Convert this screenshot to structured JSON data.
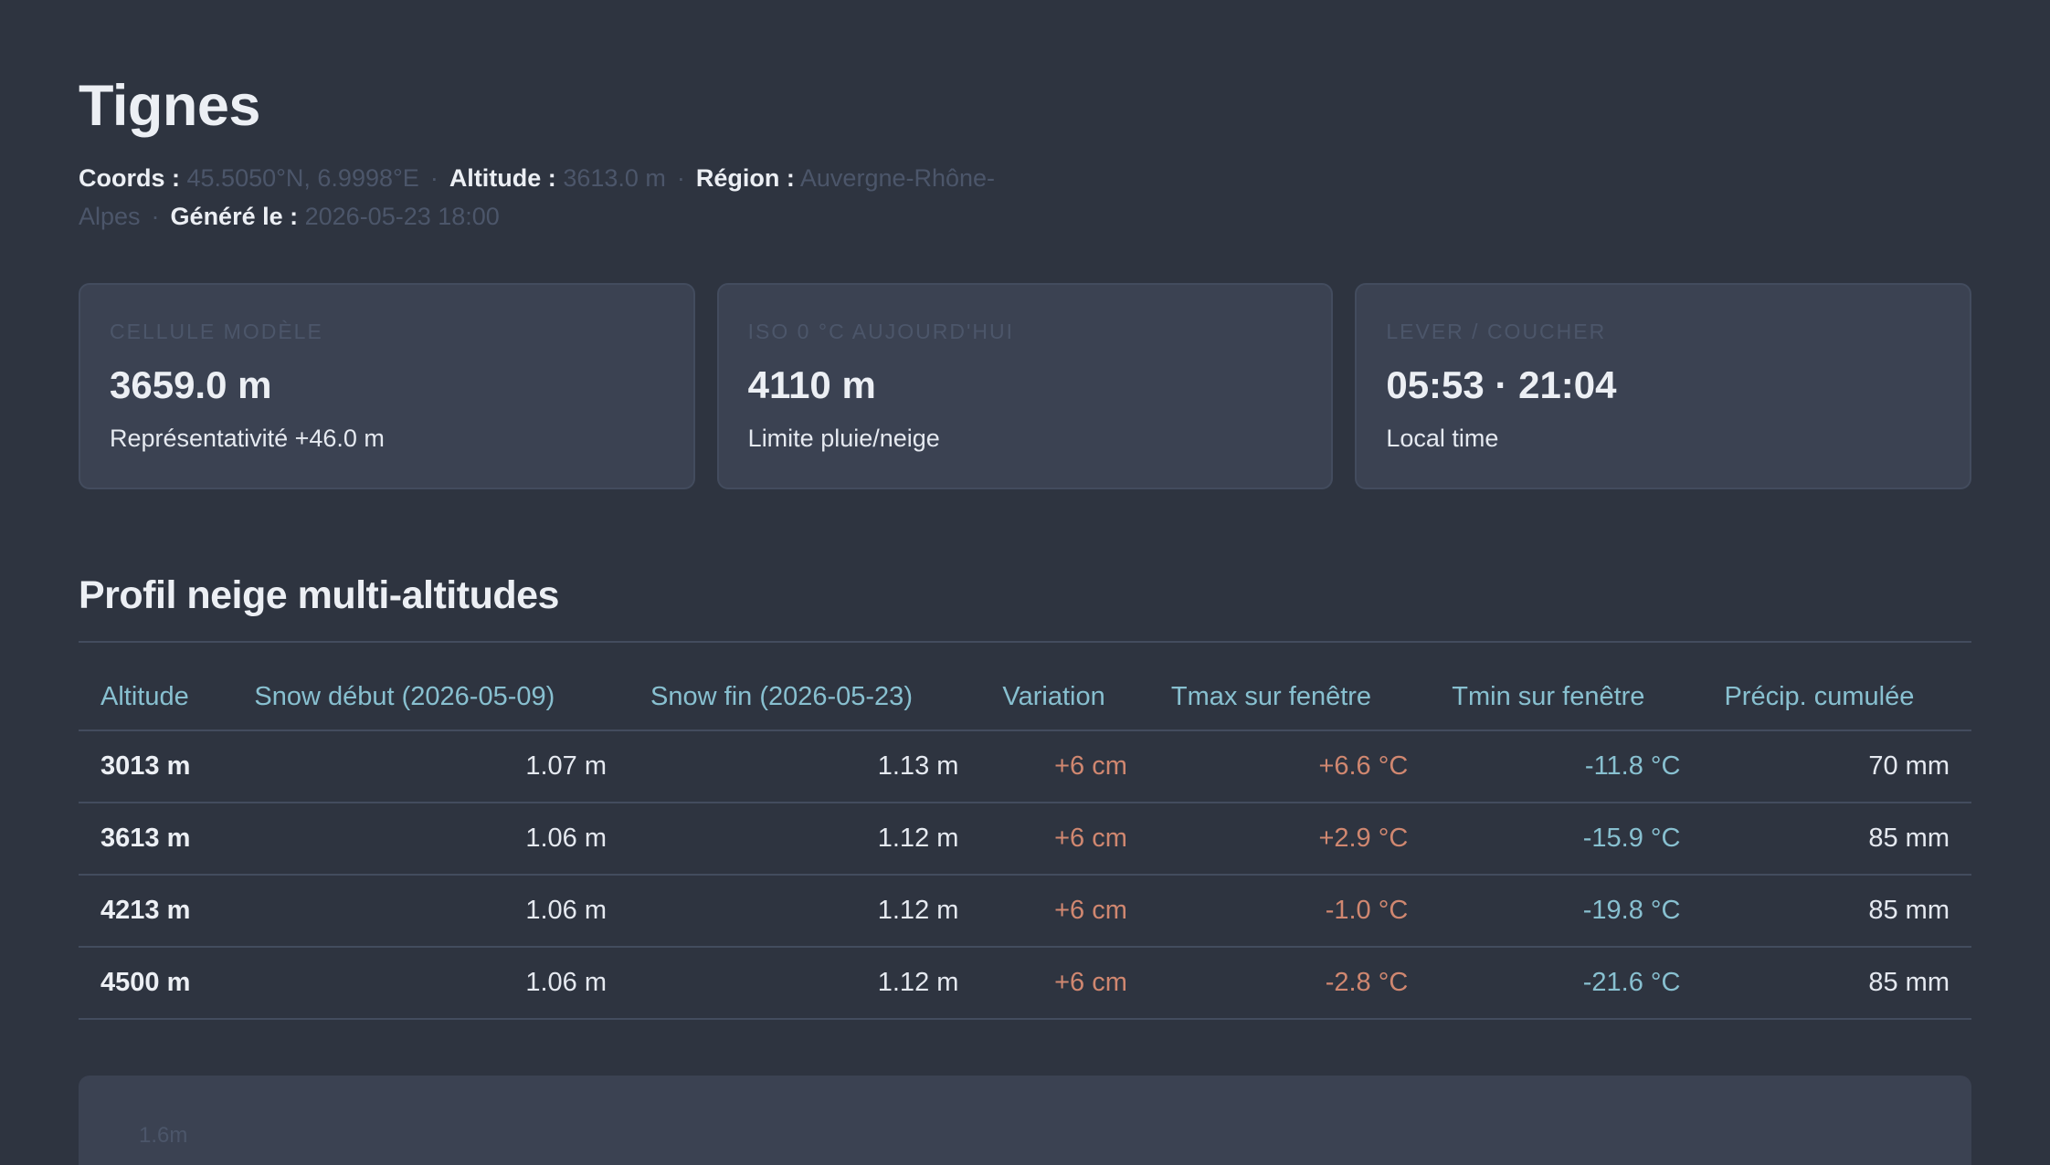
{
  "station": {
    "name": "Tignes",
    "coords_label": "Coords :",
    "coords_value": "45.5050°N, 6.9998°E",
    "altitude_label": "Altitude :",
    "altitude_value": "3613.0 m",
    "region_label": "Région :",
    "region_value": "Auvergne-Rhône-Alpes",
    "generated_label": "Généré le :",
    "generated_value": "2026-05-23 18:00",
    "separator": "·"
  },
  "cards": [
    {
      "label": "Cellule modèle",
      "value": "3659.0 m",
      "sub": "Représentativité +46.0 m"
    },
    {
      "label": "ISO 0 °C aujourd'hui",
      "value": "4110 m",
      "sub": "Limite pluie/neige"
    },
    {
      "label": "Lever / coucher",
      "value": "05:53 · 21:04",
      "sub": "Local time"
    }
  ],
  "profile": {
    "title": "Profil neige multi-altitudes",
    "columns": [
      "Altitude",
      "Snow début (2026-05-09)",
      "Snow fin (2026-05-23)",
      "Variation",
      "Tmax sur fenêtre",
      "Tmin sur fenêtre",
      "Précip. cumulée"
    ],
    "rows": [
      [
        "3013 m",
        "1.07 m",
        "1.13 m",
        "+6 cm",
        "+6.6 °C",
        "-11.8 °C",
        "70 mm"
      ],
      [
        "3613 m",
        "1.06 m",
        "1.12 m",
        "+6 cm",
        "+2.9 °C",
        "-15.9 °C",
        "85 mm"
      ],
      [
        "4213 m",
        "1.06 m",
        "1.12 m",
        "+6 cm",
        "-1.0 °C",
        "-19.8 °C",
        "85 mm"
      ],
      [
        "4500 m",
        "1.06 m",
        "1.12 m",
        "+6 cm",
        "-2.8 °C",
        "-21.6 °C",
        "85 mm"
      ]
    ]
  },
  "chart": {
    "y_tick_top": "1.6m"
  },
  "colors": {
    "background": "#2e3440",
    "panel": "#3b4252",
    "accent": "#88c0d0",
    "warm": "#d08770"
  }
}
